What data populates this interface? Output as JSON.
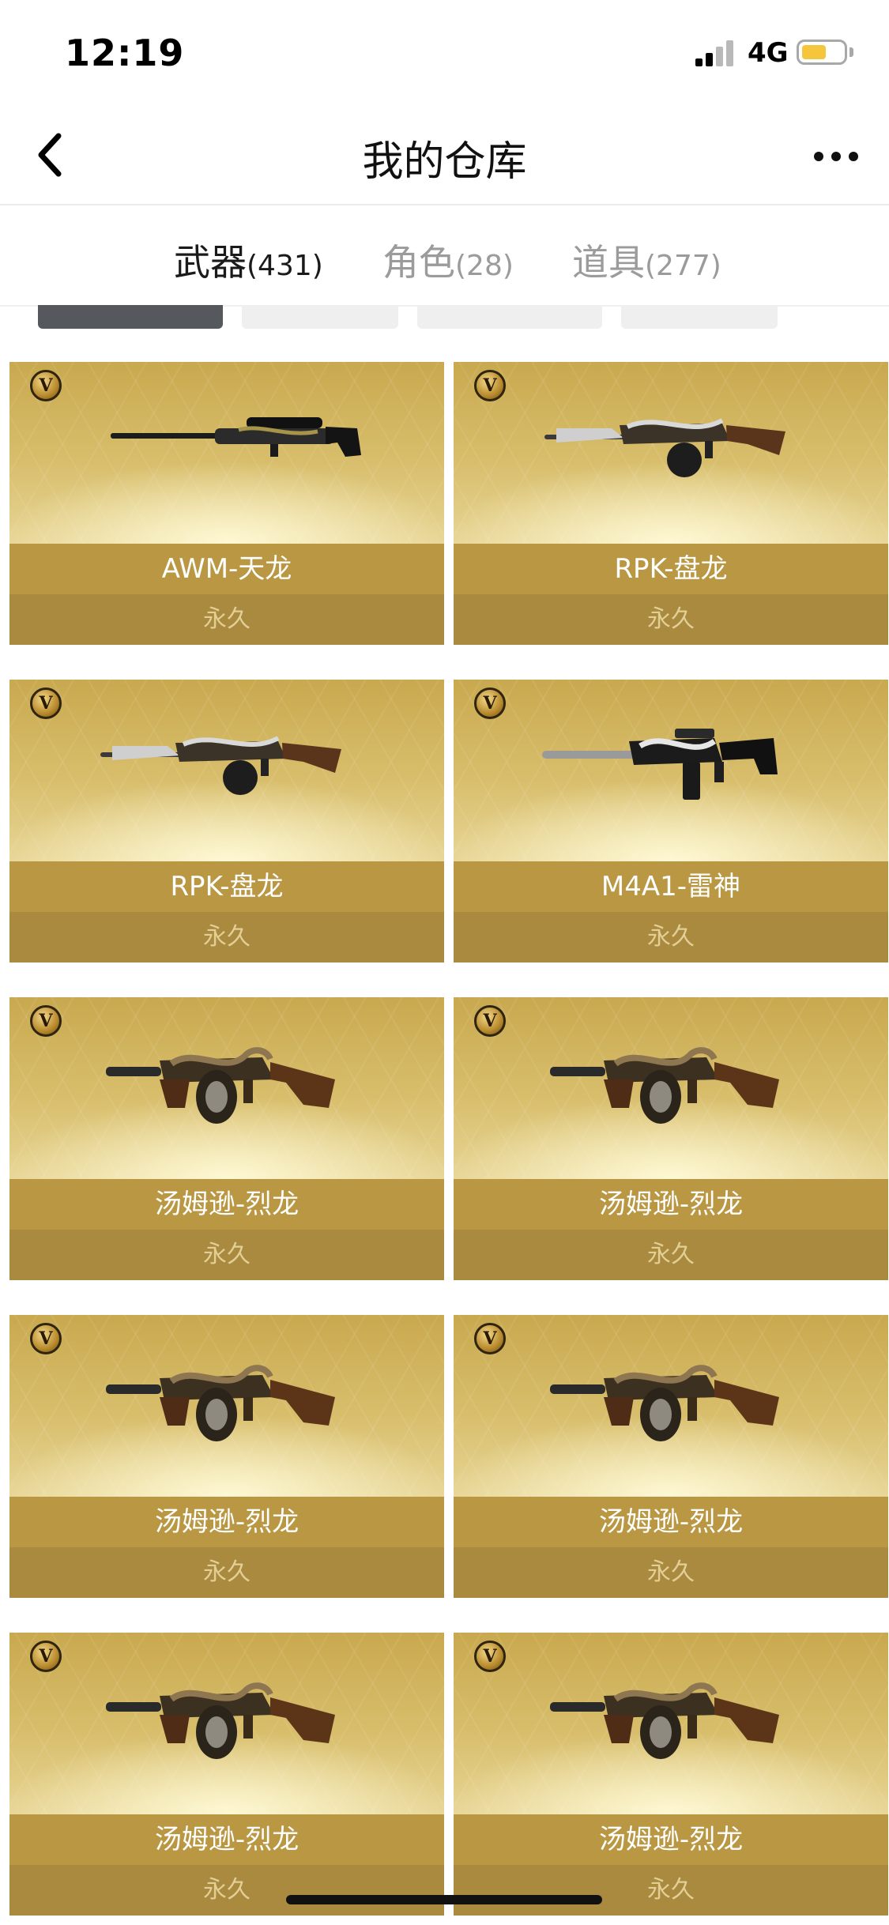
{
  "status_bar": {
    "time": "12:19",
    "network": "4G",
    "battery_level": 0.6,
    "battery_color": "#f5c53c"
  },
  "nav": {
    "title": "我的仓库",
    "back_icon": "chevron-left-icon",
    "more_icon": "more-icon"
  },
  "tabs": [
    {
      "label": "武器",
      "count": "(431)",
      "active": true
    },
    {
      "label": "角色",
      "count": "(28)",
      "active": false
    },
    {
      "label": "道具",
      "count": "(277)",
      "active": false
    }
  ],
  "filter_chips": [
    {
      "active": true
    },
    {
      "active": false
    },
    {
      "active": false
    },
    {
      "active": false
    }
  ],
  "colors": {
    "card_gold": "#c9a94f",
    "name_bar": "#b99743",
    "duration_bar": "#a98a3e",
    "duration_text": "#e3cf96"
  },
  "items": [
    {
      "name": "AWM-天龙",
      "duration": "永久",
      "badge": "V",
      "gun": "sniper"
    },
    {
      "name": "RPK-盘龙",
      "duration": "永久",
      "badge": "V",
      "gun": "rpk"
    },
    {
      "name": "RPK-盘龙",
      "duration": "永久",
      "badge": "V",
      "gun": "rpk"
    },
    {
      "name": "M4A1-雷神",
      "duration": "永久",
      "badge": "V",
      "gun": "m4a1"
    },
    {
      "name": "汤姆逊-烈龙",
      "duration": "永久",
      "badge": "V",
      "gun": "thompson"
    },
    {
      "name": "汤姆逊-烈龙",
      "duration": "永久",
      "badge": "V",
      "gun": "thompson"
    },
    {
      "name": "汤姆逊-烈龙",
      "duration": "永久",
      "badge": "V",
      "gun": "thompson"
    },
    {
      "name": "汤姆逊-烈龙",
      "duration": "永久",
      "badge": "V",
      "gun": "thompson"
    },
    {
      "name": "汤姆逊-烈龙",
      "duration": "永久",
      "badge": "V",
      "gun": "thompson"
    },
    {
      "name": "汤姆逊-烈龙",
      "duration": "永久",
      "badge": "V",
      "gun": "thompson"
    }
  ]
}
